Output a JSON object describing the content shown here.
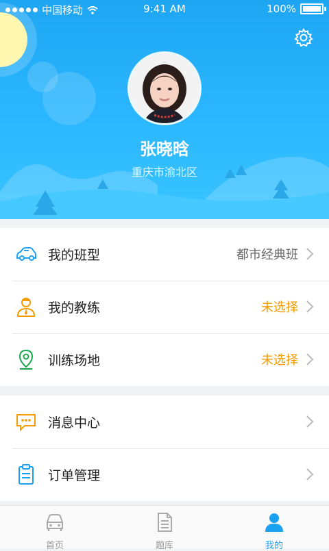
{
  "status_bar": {
    "carrier": "中国移动",
    "time": "9:41 AM",
    "battery": "100%"
  },
  "profile": {
    "name": "张晓晗",
    "location": "重庆市渝北区"
  },
  "menu": [
    {
      "label": "我的班型",
      "value": "都市经典班",
      "icon": "car-icon"
    },
    {
      "label": "我的教练",
      "value": "未选择",
      "icon": "coach-icon"
    },
    {
      "label": "训练场地",
      "value": "未选择",
      "icon": "location-pin-icon"
    }
  ],
  "menu2": [
    {
      "label": "消息中心",
      "icon": "message-icon"
    },
    {
      "label": "订单管理",
      "icon": "clipboard-icon"
    }
  ],
  "tabs": [
    {
      "label": "首页",
      "icon": "car-front-icon"
    },
    {
      "label": "题库",
      "icon": "document-icon"
    },
    {
      "label": "我的",
      "icon": "user-icon"
    }
  ],
  "colors": {
    "accent": "#1aa1f1",
    "orange": "#f39b00",
    "header_top": "#1ea6f3",
    "header_bottom": "#39c4ff"
  }
}
